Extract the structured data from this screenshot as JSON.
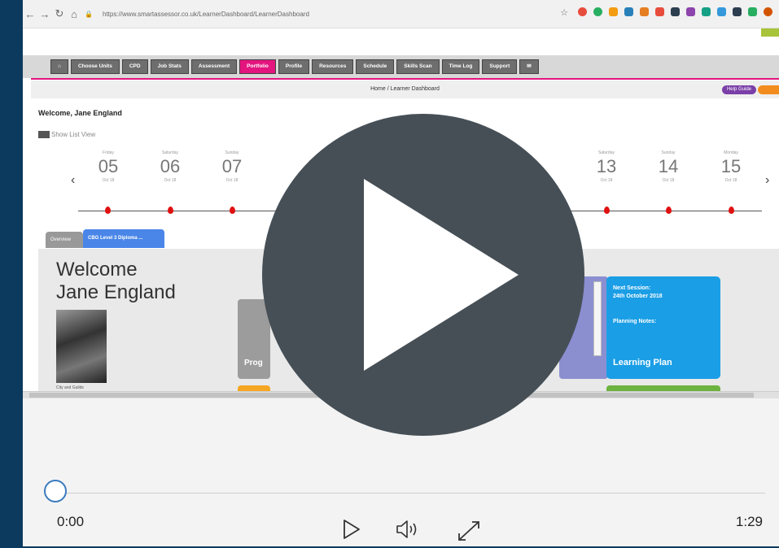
{
  "browser": {
    "url": "https://www.smartassessor.co.uk/LearnerDashboard/LearnerDashboard"
  },
  "menu": {
    "home_icon": "home-icon",
    "items": [
      "Choose Units",
      "CPD",
      "Job Stats",
      "Assessment",
      "Portfolio",
      "Profile",
      "Resources",
      "Schedule",
      "Skills Scan",
      "Time Log",
      "Support"
    ],
    "active": "Portfolio",
    "mail_icon": "mail-icon"
  },
  "breadcrumb": "Home / Learner Dashboard",
  "help_guide": "Help Guide",
  "welcome_header": "Welcome, Jane England",
  "list_view": "Show List View",
  "timeline": {
    "days": [
      {
        "wd": "Friday",
        "num": "05",
        "mo": "Oct 18"
      },
      {
        "wd": "Saturday",
        "num": "06",
        "mo": "Oct 18"
      },
      {
        "wd": "Sunday",
        "num": "07",
        "mo": "Oct 18"
      },
      {
        "wd": "Saturday",
        "num": "13",
        "mo": "Oct 18"
      },
      {
        "wd": "Sunday",
        "num": "14",
        "mo": "Oct 18"
      },
      {
        "wd": "Monday",
        "num": "15",
        "mo": "Oct 18"
      }
    ],
    "prev": "‹",
    "next": "›"
  },
  "tabs": {
    "overview": "Overview",
    "course": "CBG Level 3 Diploma ..."
  },
  "card": {
    "welcome_line1": "Welcome",
    "welcome_line2": "Jane England",
    "avatar_caption": "City and Guilds",
    "progress_label": "Prog",
    "next_session_title": "Next Session:",
    "next_session_date": "24th October 2018",
    "planning_notes": "Planning Notes:",
    "learning_plan": "Learning Plan"
  },
  "player": {
    "current_time": "0:00",
    "total_time": "1:29",
    "progress": 0,
    "play_icon": "play-icon",
    "volume_icon": "volume-icon",
    "fullscreen_icon": "fullscreen-icon"
  },
  "colors": {
    "accent_pink": "#e4157f",
    "card_blue": "#1a9ee6",
    "card_purple": "#8b8fd0",
    "background": "#0c3a5e"
  }
}
